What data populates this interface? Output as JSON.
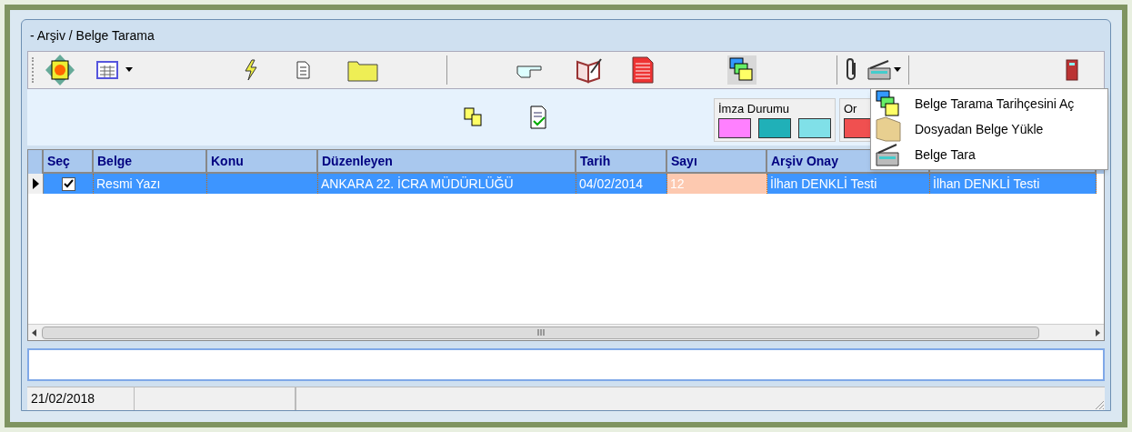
{
  "window": {
    "title": "- Arşiv / Belge Tarama"
  },
  "legend": [
    {
      "label": "İmza Durumu",
      "swatches": [
        {
          "color": "#ff80ff"
        },
        {
          "color": "#20b0b8"
        },
        {
          "color": "#80e0e8"
        }
      ]
    },
    {
      "label": "Or",
      "swatches": [
        {
          "color": "#f05050"
        }
      ]
    }
  ],
  "menu": [
    {
      "kind": "history",
      "label": "Belge Tarama Tarihçesini Aç"
    },
    {
      "kind": "folder",
      "label": "Dosyadan Belge Yükle"
    },
    {
      "kind": "scanner",
      "label": "Belge Tara"
    }
  ],
  "table": {
    "columns": [
      "Seç",
      "Belge",
      "Konu",
      "Düzenleyen",
      "Tarih",
      "Sayı",
      "Arşiv Onay"
    ],
    "rows": [
      {
        "selected": true,
        "cells": [
          {
            "kind": "checkbox",
            "checked": true,
            "focused": false
          },
          {
            "text": "Resmi Yazı",
            "focused": false
          },
          {
            "text": "",
            "focused": false
          },
          {
            "text": "ANKARA 22. İCRA MÜDÜRLÜĞÜ",
            "focused": false
          },
          {
            "text": "04/02/2014",
            "focused": false
          },
          {
            "text": "12",
            "focused": true
          },
          {
            "text": "İlhan DENKLİ Testi",
            "focused": false
          },
          {
            "text": "İlhan DENKLİ Testi",
            "focused": false
          }
        ]
      }
    ]
  },
  "status_bar": {
    "date": "21/02/2018"
  }
}
